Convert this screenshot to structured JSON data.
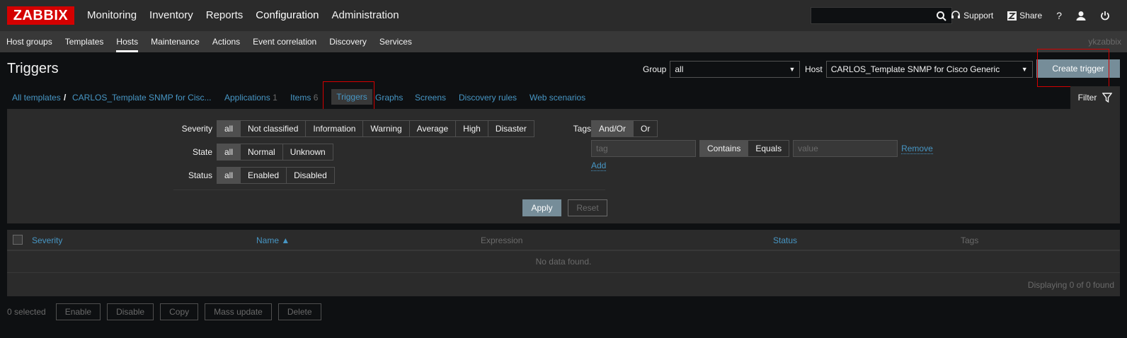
{
  "brand": {
    "logo_text": "ZABBIX"
  },
  "main_nav": [
    {
      "label": "Monitoring"
    },
    {
      "label": "Inventory"
    },
    {
      "label": "Reports"
    },
    {
      "label": "Configuration"
    },
    {
      "label": "Administration"
    }
  ],
  "top_links": {
    "support": "Support",
    "share": "Share",
    "help": "?"
  },
  "sub_nav": [
    {
      "label": "Host groups"
    },
    {
      "label": "Templates"
    },
    {
      "label": "Hosts"
    },
    {
      "label": "Maintenance"
    },
    {
      "label": "Actions"
    },
    {
      "label": "Event correlation"
    },
    {
      "label": "Discovery"
    },
    {
      "label": "Services"
    }
  ],
  "username": "ykzabbix",
  "header": {
    "title": "Triggers",
    "group_label": "Group",
    "group_value": "all",
    "host_label": "Host",
    "host_value": "CARLOS_Template SNMP for Cisco Generic",
    "create_button": "Create trigger"
  },
  "breadcrumb": {
    "all_templates": "All templates",
    "separator": "/",
    "template": "CARLOS_Template SNMP for Cisc...",
    "applications": "Applications",
    "applications_count": "1",
    "items": "Items",
    "items_count": "6",
    "triggers": "Triggers",
    "graphs": "Graphs",
    "screens": "Screens",
    "discovery_rules": "Discovery rules",
    "web_scenarios": "Web scenarios",
    "filter": "Filter"
  },
  "filter": {
    "severity_label": "Severity",
    "severity_options": [
      "all",
      "Not classified",
      "Information",
      "Warning",
      "Average",
      "High",
      "Disaster"
    ],
    "state_label": "State",
    "state_options": [
      "all",
      "Normal",
      "Unknown"
    ],
    "status_label": "Status",
    "status_options": [
      "all",
      "Enabled",
      "Disabled"
    ],
    "tags_label": "Tags",
    "tags_logic": [
      "And/Or",
      "Or"
    ],
    "tag_placeholder": "tag",
    "tag_operators": [
      "Contains",
      "Equals"
    ],
    "value_placeholder": "value",
    "remove_link": "Remove",
    "add_link": "Add",
    "apply": "Apply",
    "reset": "Reset"
  },
  "table": {
    "columns": {
      "severity": "Severity",
      "name": "Name ▲",
      "expression": "Expression",
      "status": "Status",
      "tags": "Tags"
    },
    "empty": "No data found.",
    "paging": "Displaying 0 of 0 found"
  },
  "actions": {
    "selected": "0 selected",
    "buttons": [
      "Enable",
      "Disable",
      "Copy",
      "Mass update",
      "Delete"
    ]
  },
  "colors": {
    "accent": "#d40000",
    "link": "#4796c4",
    "primary_button": "#768d99"
  }
}
